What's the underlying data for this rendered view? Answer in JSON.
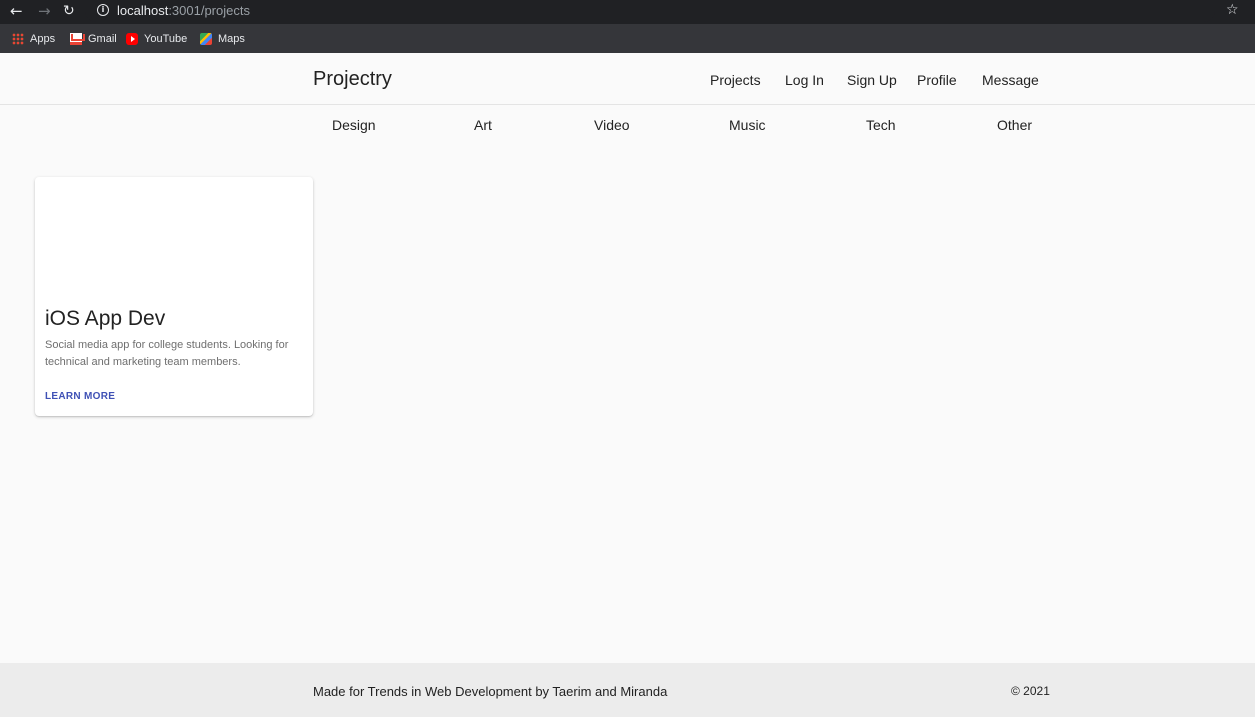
{
  "browser": {
    "url_host": "localhost",
    "url_path": ":3001/projects",
    "info_glyph": "i",
    "bookmarks": [
      {
        "label": "Apps",
        "icon": "apps-grid-icon"
      },
      {
        "label": "Gmail",
        "icon": "gmail-icon"
      },
      {
        "label": "YouTube",
        "icon": "youtube-icon"
      },
      {
        "label": "Maps",
        "icon": "maps-icon"
      }
    ]
  },
  "header": {
    "brand": "Projectry",
    "nav": [
      {
        "label": "Projects"
      },
      {
        "label": "Log In"
      },
      {
        "label": "Sign Up"
      },
      {
        "label": "Profile"
      },
      {
        "label": "Message"
      }
    ]
  },
  "categories": [
    {
      "label": "Design"
    },
    {
      "label": "Art"
    },
    {
      "label": "Video"
    },
    {
      "label": "Music"
    },
    {
      "label": "Tech"
    },
    {
      "label": "Other"
    }
  ],
  "projects": [
    {
      "title": "iOS App Dev",
      "description": "Social media app for college students. Looking for technical and marketing team members.",
      "action": "LEARN MORE"
    }
  ],
  "footer": {
    "text": "Made for Trends in Web Development by Taerim and Miranda",
    "copyright": "© 2021"
  },
  "colors": {
    "accent": "#3f51b5",
    "background": "#fafafa",
    "footer_bg": "#ececec"
  }
}
